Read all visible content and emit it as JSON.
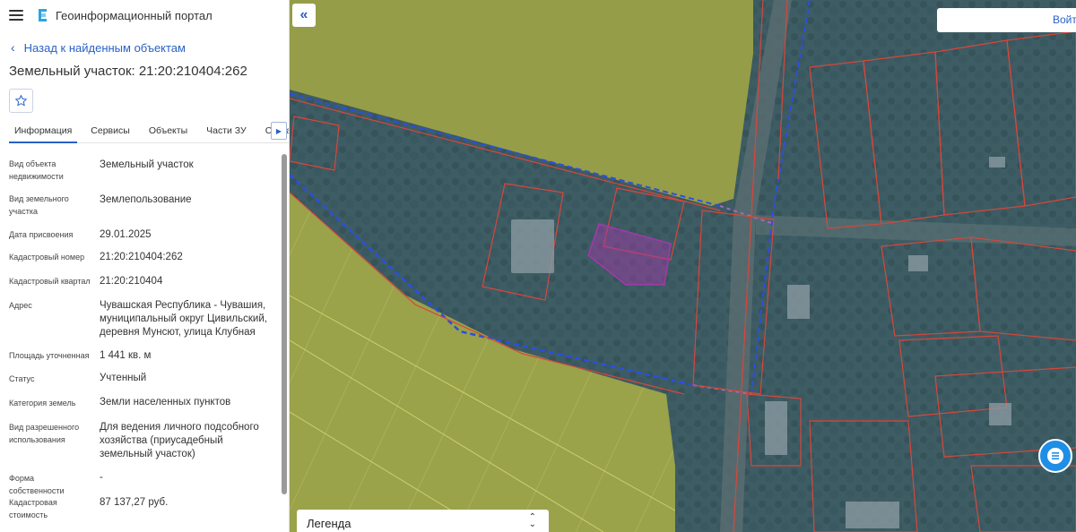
{
  "app": {
    "title": "Геоинформационный портал"
  },
  "nav": {
    "back_label": "Назад к найденным объектам"
  },
  "object": {
    "title": "Земельный участок: 21:20:210404:262"
  },
  "tabs": [
    "Информация",
    "Сервисы",
    "Объекты",
    "Части ЗУ",
    "Состав"
  ],
  "properties": [
    {
      "label": "Вид объекта недвижимости",
      "value": "Земельный участок"
    },
    {
      "label": "Вид земельного участка",
      "value": "Землепользование"
    },
    {
      "label": "Дата присвоения",
      "value": "29.01.2025"
    },
    {
      "label": "Кадастровый номер",
      "value": "21:20:210404:262"
    },
    {
      "label": "Кадастровый квартал",
      "value": "21:20:210404"
    },
    {
      "label": "Адрес",
      "value": "Чувашская Республика - Чувашия, муниципальный округ Цивильский, деревня Мунсют, улица Клубная"
    },
    {
      "label": "Площадь уточненная",
      "value": "1 441 кв. м"
    },
    {
      "label": "Статус",
      "value": "Учтенный"
    },
    {
      "label": "Категория земель",
      "value": "Земли населенных пунктов"
    },
    {
      "label": "Вид разрешенного использования",
      "value": "Для ведения личного подсобного хозяйства (приусадебный земельный участок)"
    },
    {
      "label": "Форма собственности",
      "value": "-"
    },
    {
      "label": "Кадастровая стоимость",
      "value": "87 137,27 руб."
    }
  ],
  "map": {
    "login_label": "Войти",
    "legend_label": "Легенда",
    "colors": {
      "field": "#9aa24a",
      "terrain": "#3e5c64",
      "parcel_border": "#d9463a",
      "boundary_line": "#2b4fe0",
      "selected_parcel": "#a03aa8"
    }
  },
  "icons": {
    "menu": "hamburger-icon",
    "logo": "portal-logo-icon",
    "back": "chevron-left-icon",
    "favorite": "star-icon",
    "tab_scroll": "caret-right-icon",
    "collapse": "double-chevron-left-icon",
    "chat": "chat-icon",
    "legend_toggle": "chevron-up-down-icon"
  }
}
